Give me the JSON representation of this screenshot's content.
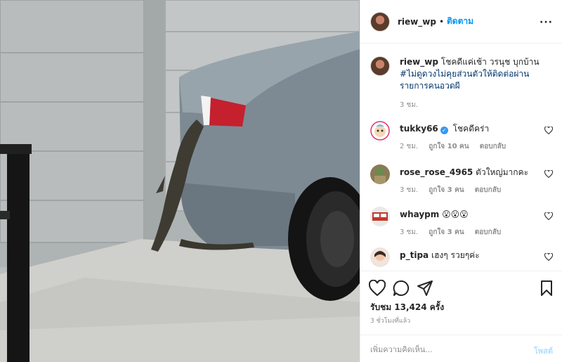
{
  "post": {
    "username": "riew_wp",
    "dot": "•",
    "follow_label": "ติดตาม",
    "more_label": "···",
    "caption_user": "riew_wp",
    "caption_text": "โชคดีแค่เช้า วรนุช บุกบ้าน",
    "caption_hashtag": "#ไม่ดูดวงไม่คุยส่วนตัวให้ติดต่อผ่านรายการคนอวดผี",
    "caption_time": "3 ชม."
  },
  "comments": [
    {
      "username": "tukky66",
      "verified": true,
      "text": "โชคดีคร่า",
      "time": "2 ชม.",
      "likes": "ถูกใจ 10 คน",
      "reply": "ตอบกลับ"
    },
    {
      "username": "rose_rose_4965",
      "verified": false,
      "text": "ตัวใหญ่มากคะ",
      "time": "3 ชม.",
      "likes": "ถูกใจ 3 คน",
      "reply": "ตอบกลับ"
    },
    {
      "username": "whaypm",
      "verified": false,
      "text": "😮😮😮",
      "time": "3 ชม.",
      "likes": "ถูกใจ 3 คน",
      "reply": "ตอบกลับ"
    },
    {
      "username": "p_tipa",
      "verified": false,
      "text": "เฮงๆ รวยๆค่ะ",
      "time": "",
      "likes": "",
      "reply": ""
    }
  ],
  "footer": {
    "likes_text": "รับชม 13,424 ครั้ง",
    "posted_time": "3 ชั่วโมงที่แล้ว",
    "comment_placeholder": "เพิ่มความคิดเห็น...",
    "post_label": "โพสต์"
  },
  "colors": {
    "accent": "#0095f6",
    "muted": "#8e8e8e"
  }
}
